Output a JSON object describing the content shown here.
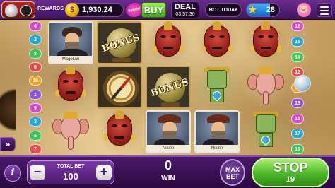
{
  "topbar": {
    "rewards_label": "REWARDS",
    "coin_symbol": "$",
    "coins": "1,930.24",
    "special_badge": "Special",
    "buy_label": "BUY",
    "deal_label": "DEAL",
    "deal_timer": "03:57:30",
    "hot_today_label": "HOT TODAY",
    "level": "28",
    "level_progress": 0.72,
    "icons": [
      "logo-icon",
      "coin-icon",
      "star-icon",
      "piggy-bank-icon",
      "menu-icon"
    ]
  },
  "paylines": {
    "left": [
      "4",
      "2",
      "8",
      "6",
      "10",
      "1",
      "9",
      "3",
      "5",
      "7"
    ],
    "right": [
      "18",
      "16",
      "14",
      "12",
      "11",
      "13",
      "15",
      "17",
      "19"
    ]
  },
  "reels": [
    [
      "portrait",
      "mask",
      "elephant"
    ],
    [
      "globe",
      "compass",
      "mask"
    ],
    [
      "mask",
      "globe",
      "portrait"
    ],
    [
      "mask",
      "idol",
      "portrait"
    ],
    [
      "mask",
      "elephant",
      "idol"
    ]
  ],
  "portrait_captions": {
    "magellan": "Magellan",
    "nikitin": "Nikitin"
  },
  "bonus_text": "BONUS",
  "bottombar": {
    "info_label": "i",
    "total_bet_label": "TOTAL BET",
    "total_bet": "100",
    "minus_label": "−",
    "plus_label": "+",
    "win_value": "0",
    "win_label": "WIN",
    "max_label_1": "MAX",
    "max_label_2": "BET",
    "stop_label": "STOP",
    "stop_lines": "19"
  },
  "expand_label": "»"
}
